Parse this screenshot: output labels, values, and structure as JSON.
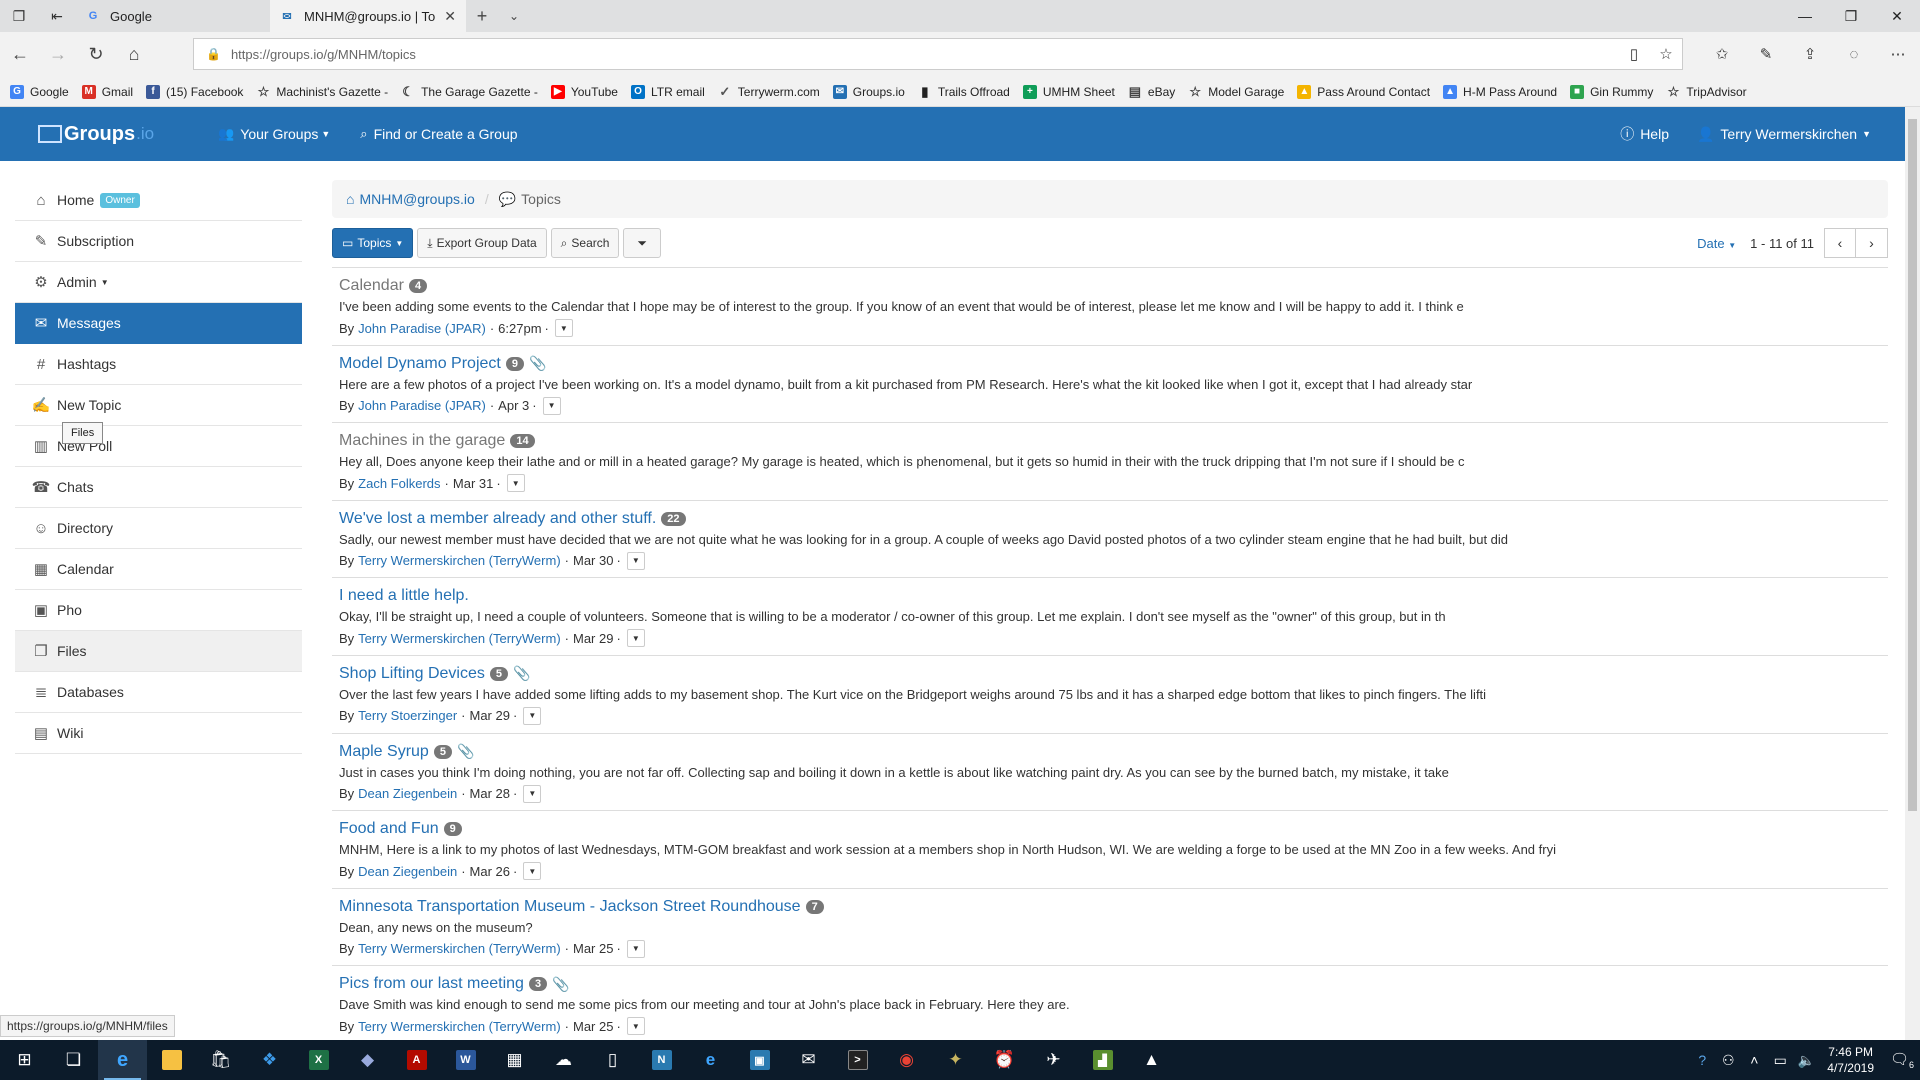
{
  "browser": {
    "tabs": [
      {
        "title": "Google",
        "icon": "google-favicon"
      },
      {
        "title": "MNHM@groups.io | Top",
        "icon": "groupsio-favicon"
      }
    ],
    "url": "https://groups.io/g/MNHM/topics",
    "favorites": [
      {
        "label": "Google",
        "icon": "google-icon",
        "color": "#4285f4"
      },
      {
        "label": "Gmail",
        "icon": "gmail-icon",
        "color": "#d93025"
      },
      {
        "label": "(15) Facebook",
        "icon": "facebook-icon",
        "color": "#3b5998"
      },
      {
        "label": "Machinist's Gazette -",
        "icon": "star-icon",
        "color": "#444444"
      },
      {
        "label": "The Garage Gazette -",
        "icon": "moon-icon",
        "color": "#444444"
      },
      {
        "label": "YouTube",
        "icon": "youtube-icon",
        "color": "#ff0000"
      },
      {
        "label": "LTR email",
        "icon": "outlook-icon",
        "color": "#0072c6"
      },
      {
        "label": "Terrywerm.com",
        "icon": "wordpress-icon",
        "color": "#555555"
      },
      {
        "label": "Groups.io",
        "icon": "envelope-icon",
        "color": "#2470b3"
      },
      {
        "label": "Trails Offroad",
        "icon": "bookmark-icon",
        "color": "#222222"
      },
      {
        "label": "UMHM Sheet",
        "icon": "sheets-icon",
        "color": "#0f9d58"
      },
      {
        "label": "eBay",
        "icon": "ebay-icon",
        "color": "#444444"
      },
      {
        "label": "Model Garage",
        "icon": "star-icon",
        "color": "#444444"
      },
      {
        "label": "Pass Around Contact",
        "icon": "drive-icon",
        "color": "#f4b400"
      },
      {
        "label": "H-M Pass Around",
        "icon": "drive-icon",
        "color": "#4285f4"
      },
      {
        "label": "Gin Rummy",
        "icon": "game-icon",
        "color": "#2ea44f"
      },
      {
        "label": "TripAdvisor",
        "icon": "star-icon",
        "color": "#444444"
      }
    ],
    "status_url": "https://groups.io/g/MNHM/files"
  },
  "header": {
    "logo_main": "Groups",
    "logo_io": ".io",
    "your_groups": "Your Groups",
    "find_create": "Find or Create a Group",
    "help": "Help",
    "user": "Terry Wermerskirchen"
  },
  "sidebar": {
    "items": [
      {
        "label": "Home",
        "icon": "home-icon",
        "glyph": "⌂"
      },
      {
        "label": "Subscription",
        "icon": "pencil-icon",
        "glyph": "✎"
      },
      {
        "label": "Admin",
        "icon": "gear-icon",
        "glyph": "⚙"
      },
      {
        "label": "Messages",
        "icon": "chat-bubbles-icon",
        "glyph": "✉"
      },
      {
        "label": "Hashtags",
        "icon": "hash-icon",
        "glyph": "#"
      },
      {
        "label": "New Topic",
        "icon": "edit-icon",
        "glyph": "✍"
      },
      {
        "label": "New Poll",
        "icon": "bar-chart-icon",
        "glyph": "▥"
      },
      {
        "label": "Chats",
        "icon": "phone-icon",
        "glyph": "☎"
      },
      {
        "label": "Directory",
        "icon": "users-icon",
        "glyph": "☺"
      },
      {
        "label": "Calendar",
        "icon": "calendar-icon",
        "glyph": "▦"
      },
      {
        "label": "Pho",
        "icon": "photo-icon",
        "glyph": "▣"
      },
      {
        "label": "Files",
        "icon": "files-icon",
        "glyph": "❐"
      },
      {
        "label": "Databases",
        "icon": "database-icon",
        "glyph": "≣"
      },
      {
        "label": "Wiki",
        "icon": "book-icon",
        "glyph": "▤"
      }
    ],
    "owner_badge": "Owner",
    "tooltip": "Files"
  },
  "breadcrumb": {
    "group": "MNHM@groups.io",
    "current": "Topics"
  },
  "toolbar": {
    "topics": "Topics",
    "export": "Export Group Data",
    "search": "Search",
    "sort": "Date",
    "range": "1 - 11 of 11"
  },
  "topics": [
    {
      "title": "Calendar",
      "count": "4",
      "clip": false,
      "read": true,
      "snippet": "I've been adding some events to the Calendar that I hope may be of interest to the group. If you know of an event that would be of interest, please let me know and I will be happy to add it. I think e",
      "author": "John Paradise (JPAR)",
      "date": "6:27pm"
    },
    {
      "title": "Model Dynamo Project",
      "count": "9",
      "clip": true,
      "read": false,
      "snippet": "Here are a few photos of a project I've been working on. It's a model dynamo, built from a kit purchased from PM Research. Here's what the kit looked like when I got it, except that I had already star",
      "author": "John Paradise (JPAR)",
      "date": "Apr 3"
    },
    {
      "title": "Machines in the garage",
      "count": "14",
      "clip": false,
      "read": true,
      "snippet": "Hey all, Does anyone keep their lathe and or mill in a heated garage? My garage is heated, which is phenomenal, but it gets so humid in their with the truck dripping that I'm not sure if I should be c",
      "author": "Zach Folkerds",
      "date": "Mar 31"
    },
    {
      "title": "We've lost a member already and other stuff.",
      "count": "22",
      "clip": false,
      "read": false,
      "snippet": "Sadly, our newest member must have decided that we are not quite what he was looking for in a group. A couple of weeks ago David posted photos of a two cylinder steam engine that he had built, but did",
      "author": "Terry Wermerskirchen (TerryWerm)",
      "date": "Mar 30"
    },
    {
      "title": "I need a little help.",
      "count": "",
      "clip": false,
      "read": false,
      "snippet": "Okay, I'll be straight up, I need a couple of volunteers. Someone that is willing to be a moderator / co-owner of this group. Let me explain. I don't see myself as the \"owner\" of this group, but in th",
      "author": "Terry Wermerskirchen (TerryWerm)",
      "date": "Mar 29"
    },
    {
      "title": "Shop Lifting Devices",
      "count": "5",
      "clip": true,
      "read": false,
      "snippet": "Over the last few years I have added some lifting adds to my basement shop. The Kurt vice on the Bridgeport weighs around 75 lbs and it has a sharped edge bottom that likes to pinch fingers. The lifti",
      "author": "Terry Stoerzinger",
      "date": "Mar 29"
    },
    {
      "title": "Maple Syrup",
      "count": "5",
      "clip": true,
      "read": false,
      "snippet": "Just in cases you think I'm doing nothing, you are not far off. Collecting sap and boiling it down in a kettle is about like watching paint dry. As you can see by the burned batch, my mistake, it take",
      "author": "Dean Ziegenbein",
      "date": "Mar 28"
    },
    {
      "title": "Food and Fun",
      "count": "9",
      "clip": false,
      "read": false,
      "snippet": "MNHM, Here is a link to my photos of last Wednesdays, MTM-GOM breakfast and work session at a members shop in North Hudson, WI. We are welding a forge to be used at the MN Zoo in a few weeks. And fryi",
      "author": "Dean Ziegenbein",
      "date": "Mar 26"
    },
    {
      "title": "Minnesota Transportation Museum - Jackson Street Roundhouse",
      "count": "7",
      "clip": false,
      "read": false,
      "snippet": "Dean, any news on the museum?",
      "author": "Terry Wermerskirchen (TerryWerm)",
      "date": "Mar 25"
    },
    {
      "title": "Pics from our last meeting",
      "count": "3",
      "clip": true,
      "read": false,
      "snippet": "Dave Smith was kind enough to send me some pics from our meeting and tour at John's place back in February. Here they are.",
      "author": "Terry Wermerskirchen (TerryWerm)",
      "date": "Mar 25"
    }
  ],
  "meta_by": "By",
  "taskbar": {
    "time": "7:46 PM",
    "date": "4/7/2019",
    "notif_count": "6"
  }
}
